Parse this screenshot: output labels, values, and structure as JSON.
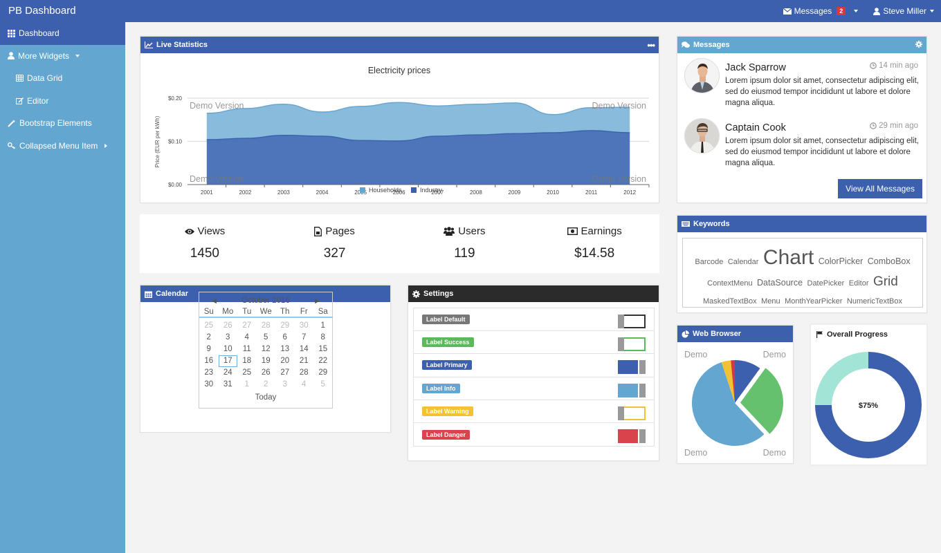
{
  "topbar": {
    "brand": "PB Dashboard",
    "messages_label": "Messages",
    "messages_count": "2",
    "user_name": "Steve Miller"
  },
  "sidebar": {
    "items": [
      {
        "label": "Dashboard",
        "icon": "grid-icon",
        "active": true
      },
      {
        "label": "More Widgets",
        "icon": "user-icon",
        "caret": "down"
      },
      {
        "label": "Data Grid",
        "icon": "table-icon",
        "sub": true
      },
      {
        "label": "Editor",
        "icon": "edit-icon",
        "sub": true
      },
      {
        "label": "Bootstrap Elements",
        "icon": "magic-wand-icon"
      },
      {
        "label": "Collapsed Menu Item",
        "icon": "key-icon",
        "caret": "right"
      }
    ]
  },
  "live_stats": {
    "title": "Live Statistics",
    "menu_icon": "ellipsis-icon",
    "watermark": "Demo Version"
  },
  "chart_data": [
    {
      "type": "area",
      "stacked": true,
      "title": "Electricity prices",
      "xlabel": "",
      "ylabel": "Price (EUR per kWh)",
      "x": [
        "2001",
        "2002",
        "2003",
        "2004",
        "2005",
        "2006",
        "2007",
        "2008",
        "2009",
        "2010",
        "2011",
        "2012"
      ],
      "yticks": [
        "$0.00",
        "$0.10",
        "$0.20"
      ],
      "ylim": [
        0,
        0.2
      ],
      "grid": true,
      "legend": "bottom",
      "series": [
        {
          "name": "Households",
          "color": "#88bbdc",
          "values": [
            0.061,
            0.069,
            0.072,
            0.056,
            0.079,
            0.089,
            0.07,
            0.071,
            0.071,
            0.042,
            0.053,
            0.059
          ]
        },
        {
          "name": "Industry",
          "color": "#4e74b9",
          "values": [
            0.104,
            0.107,
            0.114,
            0.112,
            0.102,
            0.101,
            0.112,
            0.115,
            0.118,
            0.12,
            0.125,
            0.12
          ]
        }
      ]
    },
    {
      "type": "pie",
      "title": "Web Browser",
      "watermark": "Demo",
      "slices": [
        {
          "value": 10,
          "color": "#3c60ad"
        },
        {
          "value": 28,
          "color": "#66c16e",
          "exploded": true
        },
        {
          "value": 57,
          "color": "#63a7d1"
        },
        {
          "value": 3.5,
          "color": "#f2c232"
        },
        {
          "value": 1.5,
          "color": "#d9363e"
        }
      ]
    },
    {
      "type": "pie",
      "donut": true,
      "title": "Overall Progress",
      "center_label": "$75%",
      "slices": [
        {
          "name": "complete",
          "value": 75,
          "color": "#3c60ad"
        },
        {
          "name": "remaining",
          "value": 25,
          "color": "#a2e4d6"
        }
      ]
    }
  ],
  "stats": [
    {
      "label": "Views",
      "value": "1450",
      "icon": "eye-icon"
    },
    {
      "label": "Pages",
      "value": "327",
      "icon": "file-icon"
    },
    {
      "label": "Users",
      "value": "119",
      "icon": "users-icon"
    },
    {
      "label": "Earnings",
      "value": "$14.58",
      "icon": "money-icon"
    }
  ],
  "calendar": {
    "title": "Calendar",
    "month": "October 2016",
    "dow": [
      "Su",
      "Mo",
      "Tu",
      "We",
      "Th",
      "Fr",
      "Sa"
    ],
    "days": [
      [
        "25",
        "26",
        "27",
        "28",
        "29",
        "30",
        "1"
      ],
      [
        "2",
        "3",
        "4",
        "5",
        "6",
        "7",
        "8"
      ],
      [
        "9",
        "10",
        "11",
        "12",
        "13",
        "14",
        "15"
      ],
      [
        "16",
        "17",
        "18",
        "19",
        "20",
        "21",
        "22"
      ],
      [
        "23",
        "24",
        "25",
        "26",
        "27",
        "28",
        "29"
      ],
      [
        "30",
        "31",
        "1",
        "2",
        "3",
        "4",
        "5"
      ]
    ],
    "selected": "17",
    "today_label": "Today"
  },
  "settings": {
    "title": "Settings",
    "rows": [
      {
        "label": "Label Default",
        "color": "#777777",
        "on": false
      },
      {
        "label": "Label Success",
        "color": "#5cb85c",
        "on": false
      },
      {
        "label": "Label Primary",
        "color": "#3c60ad",
        "on": true
      },
      {
        "label": "Label Info",
        "color": "#63a7d1",
        "on": true
      },
      {
        "label": "Label Warning",
        "color": "#f2c232",
        "on": false
      },
      {
        "label": "Label Danger",
        "color": "#d9434b",
        "on": true
      }
    ]
  },
  "messages": {
    "title": "Messages",
    "items": [
      {
        "name": "Jack Sparrow",
        "time": "14 min ago",
        "text": "Lorem ipsum dolor sit amet, consectetur adipiscing elit, sed do eiusmod tempor incididunt ut labore et dolore magna aliqua."
      },
      {
        "name": "Captain Cook",
        "time": "29 min ago",
        "text": "Lorem ipsum dolor sit amet, consectetur adipiscing elit, sed do eiusmod tempor incididunt ut labore et dolore magna aliqua."
      }
    ],
    "view_all": "View All Messages"
  },
  "keywords": {
    "title": "Keywords",
    "lines": [
      [
        {
          "t": "Barcode",
          "s": "s"
        },
        {
          "t": "Calendar",
          "s": "s"
        },
        {
          "t": "Chart",
          "s": "xl"
        },
        {
          "t": "ColorPicker",
          "s": "m"
        },
        {
          "t": "ComboBox",
          "s": "m"
        }
      ],
      [
        {
          "t": "ContextMenu",
          "s": "s"
        },
        {
          "t": "DataSource",
          "s": "m"
        },
        {
          "t": "DatePicker",
          "s": "s"
        },
        {
          "t": "Editor",
          "s": "s"
        },
        {
          "t": "Grid",
          "s": "l"
        }
      ],
      [
        {
          "t": "MaskedTextBox",
          "s": "s"
        },
        {
          "t": "Menu",
          "s": "s"
        },
        {
          "t": "MonthYearPicker",
          "s": "s"
        },
        {
          "t": "NumericTextBox",
          "s": "s"
        }
      ]
    ]
  },
  "web_browser": {
    "title": "Web Browser"
  },
  "overall_progress": {
    "title": "Overall Progress"
  }
}
